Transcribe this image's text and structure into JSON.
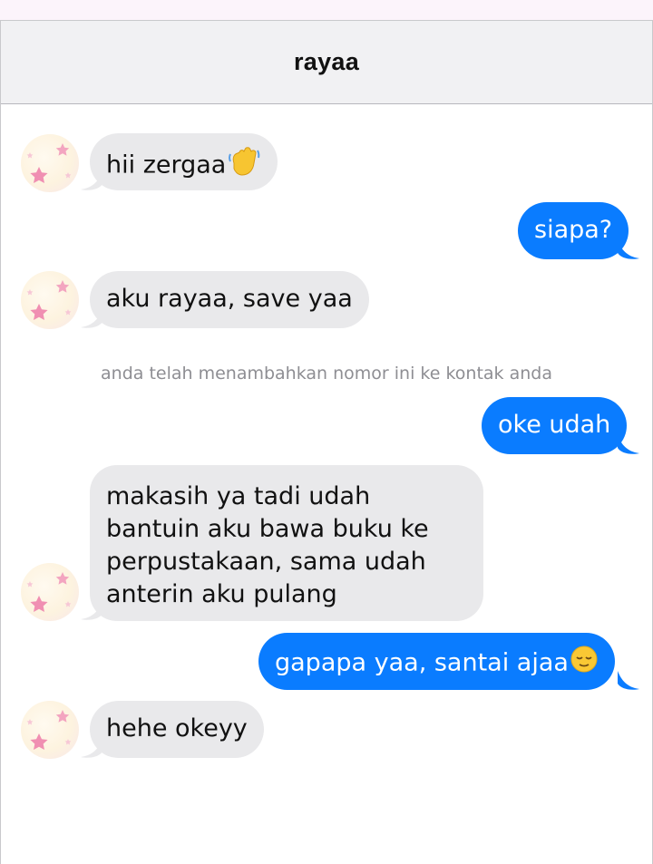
{
  "contact": {
    "name": "rayaa"
  },
  "colors": {
    "incoming_bubble": "#e9e9eb",
    "outgoing_bubble": "#0a7cff",
    "header_bg": "#f1f1f3"
  },
  "messages": [
    {
      "direction": "incoming",
      "text": "hii zergaa",
      "emoji": "waving-hand-icon"
    },
    {
      "direction": "outgoing",
      "text": "siapa?"
    },
    {
      "direction": "incoming",
      "text": "aku rayaa, save yaa"
    },
    {
      "direction": "system",
      "text": "anda telah menambahkan nomor ini ke kontak anda"
    },
    {
      "direction": "outgoing",
      "text": "oke udah"
    },
    {
      "direction": "incoming",
      "lines": [
        "makasih ya tadi udah",
        "bantuin aku bawa buku ke",
        "perpustakaan, sama udah",
        "anterin aku pulang"
      ]
    },
    {
      "direction": "outgoing",
      "text": "gapapa yaa, santai ajaa",
      "emoji": "relieved-face-icon"
    },
    {
      "direction": "incoming",
      "text": "hehe okeyy"
    }
  ]
}
